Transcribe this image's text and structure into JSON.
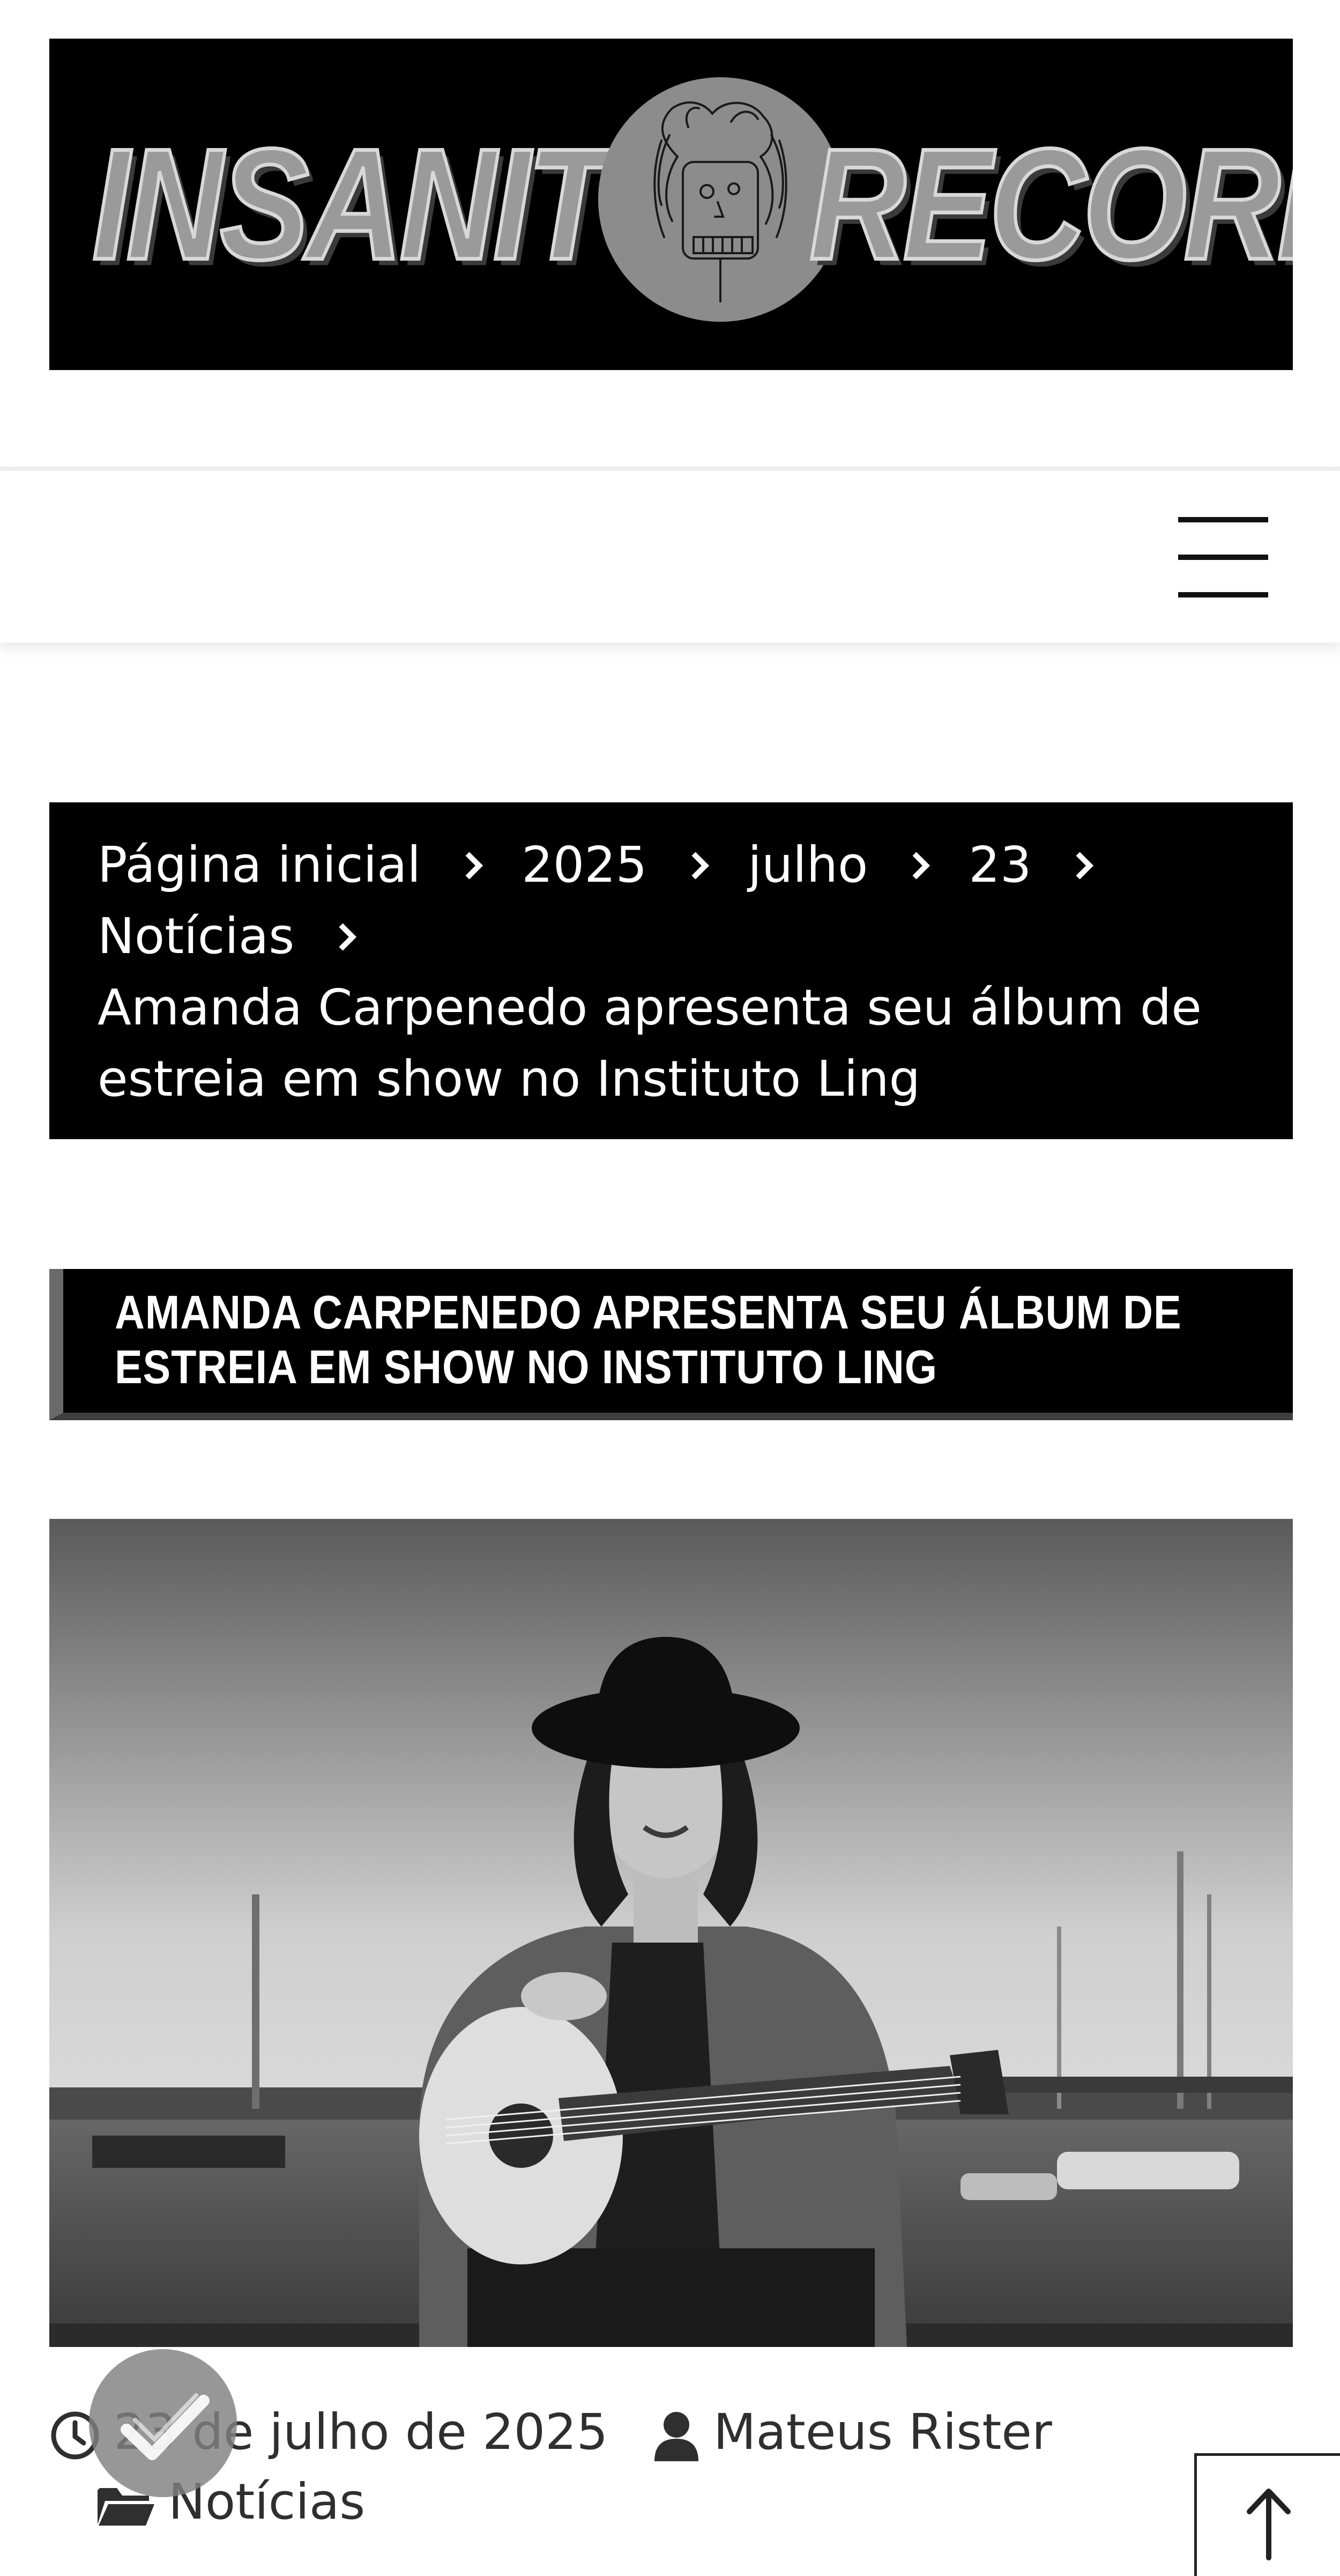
{
  "header": {
    "logo_left_word": "INSANITY",
    "logo_right_word": "RECORDS",
    "logo_emblem": "skull-face-emblem-icon"
  },
  "nav": {
    "menu_icon": "hamburger-menu-icon"
  },
  "breadcrumb": {
    "items": [
      "Página inicial",
      "2025",
      "julho",
      "23",
      "Notícias"
    ],
    "current": "Amanda Carpenedo apresenta seu álbum de estreia em show no Instituto Ling",
    "separator_icon": "chevron-right-icon"
  },
  "post": {
    "title": "AMANDA CARPENEDO APRESENTA SEU ÁLBUM DE ESTREIA EM SHOW NO INSTITUTO LING",
    "image_description_icon": "featured-photo",
    "date": "23 de julho de 2025",
    "author": "Mateus Rister",
    "category": "Notícias",
    "date_icon": "clock-icon",
    "author_icon": "user-icon",
    "category_icon": "folder-open-icon"
  },
  "widgets": {
    "check_icon": "checkmark-icon",
    "back_to_top_icon": "arrow-up-icon"
  },
  "colors": {
    "banner_bg": "#000000",
    "title_accent": "#6a6a6a",
    "text_dark": "#2f2f2f"
  }
}
